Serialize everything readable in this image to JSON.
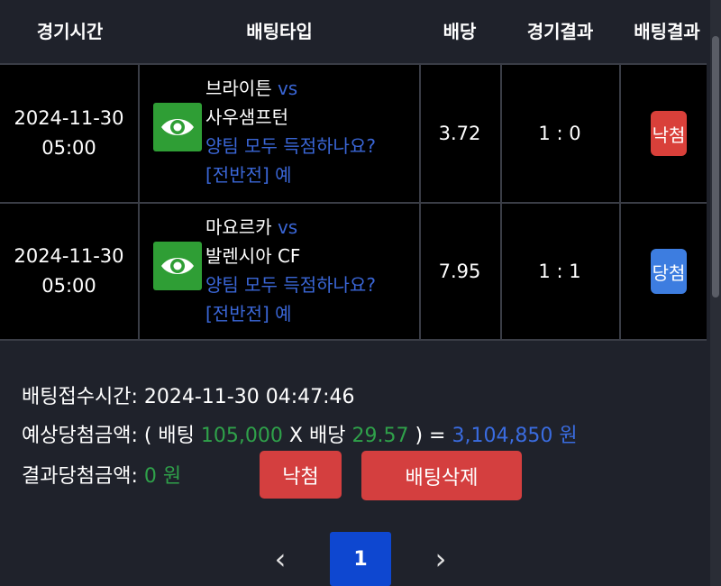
{
  "header": {
    "col_time": "경기시간",
    "col_type": "배팅타입",
    "col_odds": "배당",
    "col_result": "경기결과",
    "col_bet_result": "배팅결과"
  },
  "rows": [
    {
      "date": "2024-11-30",
      "time": "05:00",
      "home": "브라이튼",
      "vs": "vs",
      "away": "사우샘프턴",
      "question": "양팀 모두 득점하나요?",
      "pick": "[전반전] 예",
      "odds": "3.72",
      "score": "1 : 0",
      "result": "낙첨",
      "result_color": "#d9403a"
    },
    {
      "date": "2024-11-30",
      "time": "05:00",
      "home": "마요르카",
      "vs": "vs",
      "away": "발렌시아 CF",
      "question": "양팀 모두 득점하나요?",
      "pick": "[전반전] 예",
      "odds": "7.95",
      "score": "1 : 1",
      "result": "당첨",
      "result_color": "#3d7de0"
    }
  ],
  "summary": {
    "receipt_label": "배팅접수시간:",
    "receipt_value": "2024-11-30 04:47:46",
    "expected_label": "예상당첨금액:",
    "open_paren": "( 배팅",
    "stake": "105,000",
    "times": "X 배당",
    "total_odds": "29.57",
    "close_paren": ") =",
    "expected_amount": "3,104,850 원",
    "result_label": "결과당첨금액:",
    "result_amount": "0 원",
    "status_button": "낙첨",
    "delete_button": "배팅삭제"
  },
  "pagination": {
    "prev": "‹",
    "current": "1",
    "next": "›"
  },
  "colors": {
    "background": "#1f222b",
    "table_bg": "#000000",
    "green": "#2fa14a",
    "blue": "#3a66d6",
    "red_button": "#d43f3f",
    "page_active": "#0e47d0"
  },
  "icons": {
    "view": "eye-icon"
  }
}
